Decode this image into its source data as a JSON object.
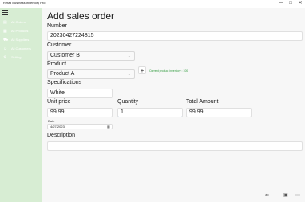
{
  "app": {
    "title": "Retail Business Inventory Pro"
  },
  "window_controls": {
    "minimize": "—",
    "maximize": "□",
    "close": "✕"
  },
  "sidebar": {
    "items": [
      {
        "label": "All Orders",
        "icon": "orders-icon",
        "glyph": "▤"
      },
      {
        "label": "All Products",
        "icon": "products-icon",
        "glyph": "▦"
      },
      {
        "label": "All Suppliers",
        "icon": "suppliers-icon",
        "glyph": "⛟"
      },
      {
        "label": "All Customers",
        "icon": "customers-icon",
        "glyph": "☺"
      },
      {
        "label": "Setting",
        "icon": "gear-icon",
        "glyph": "⚙"
      }
    ]
  },
  "form": {
    "title": "Add sales order",
    "number_label": "Number",
    "number_value": "20230427224815",
    "customer_label": "Customer",
    "customer_value": "Customer B",
    "product_label": "Product",
    "product_value": "Product A",
    "add_product": "+",
    "inventory_text": "Current product inventory : 100",
    "specifications_label": "Specifications",
    "specifications_value": "White",
    "unit_price_label": "Unit price",
    "unit_price_value": "99.99",
    "quantity_label": "Quantity",
    "quantity_value": "1",
    "total_label": "Total Amount",
    "total_value": "99.99",
    "date_label": "Date",
    "date_value": "4/27/2023",
    "description_label": "Description",
    "description_value": ""
  },
  "bottom_bar": {
    "back": "⇐",
    "save": "💾",
    "more": "⋯"
  }
}
